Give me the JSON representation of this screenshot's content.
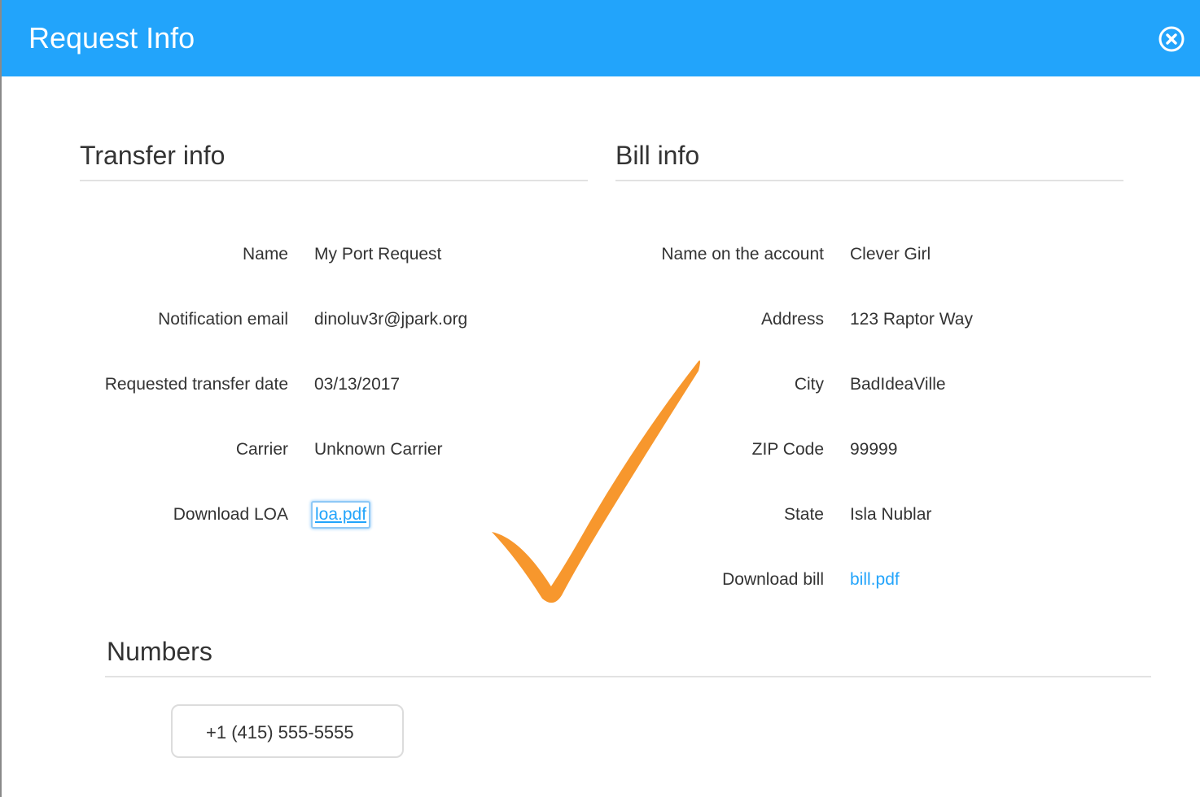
{
  "header": {
    "title": "Request Info",
    "close_icon": "close-circle-icon"
  },
  "transfer_info": {
    "title": "Transfer info",
    "rows": [
      {
        "label": "Name",
        "value": "My Port Request"
      },
      {
        "label": "Notification email",
        "value": "dinoluv3r@jpark.org"
      },
      {
        "label": "Requested transfer date",
        "value": "03/13/2017"
      },
      {
        "label": "Carrier",
        "value": "Unknown Carrier"
      },
      {
        "label": "Download LOA",
        "value": "loa.pdf"
      }
    ]
  },
  "bill_info": {
    "title": "Bill info",
    "rows": [
      {
        "label": "Name on the account",
        "value": "Clever Girl"
      },
      {
        "label": "Address",
        "value": "123 Raptor Way"
      },
      {
        "label": "City",
        "value": "BadIdeaVille"
      },
      {
        "label": "ZIP Code",
        "value": "99999"
      },
      {
        "label": "State",
        "value": "Isla Nublar"
      },
      {
        "label": "Download bill",
        "value": "bill.pdf"
      }
    ]
  },
  "numbers": {
    "title": "Numbers",
    "items": [
      "+1 (415) 555-5555"
    ]
  },
  "overlay": {
    "icon": "checkmark-icon"
  },
  "colors": {
    "header_bg": "#22a4fb",
    "link": "#22a4fb",
    "checkmark": "#f7972d",
    "rule": "#e2e2e2"
  }
}
